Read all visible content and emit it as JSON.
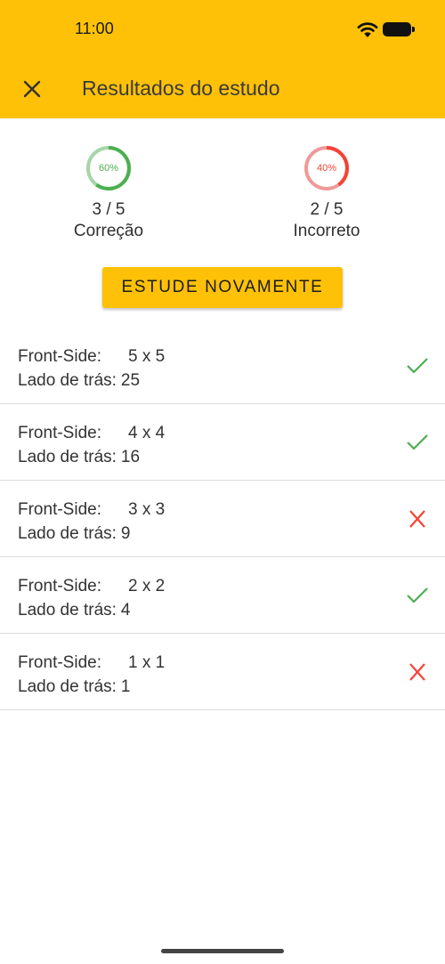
{
  "status_bar": {
    "time": "11:00",
    "wifi_icon": "wifi-icon",
    "battery_icon": "battery-icon"
  },
  "app_bar": {
    "title": "Resultados do estudo",
    "close_icon": "close-icon",
    "background": "#FFC107"
  },
  "stats": {
    "correct": {
      "percent_text": "60%",
      "fraction": 0.6,
      "count": "3 / 5",
      "label": "Correção",
      "color": "#4CAF50",
      "track_color": "#A5D6A7"
    },
    "incorrect": {
      "percent_text": "40%",
      "fraction": 0.4,
      "count": "2 / 5",
      "label": "Incorreto",
      "color": "#F44336",
      "track_color": "#EF9A9A"
    }
  },
  "study_again_button": {
    "label": "ESTUDE NOVAMENTE"
  },
  "cards": [
    {
      "front_label": "Front-Side:",
      "front_value": "5 x 5",
      "back_label": "Lado de trás:",
      "back_value": "25",
      "result": "correct",
      "icon": "check-icon"
    },
    {
      "front_label": "Front-Side:",
      "front_value": "4 x 4",
      "back_label": "Lado de trás:",
      "back_value": "16",
      "result": "correct",
      "icon": "check-icon"
    },
    {
      "front_label": "Front-Side:",
      "front_value": "3 x 3",
      "back_label": "Lado de trás:",
      "back_value": "9",
      "result": "incorrect",
      "icon": "cross-icon"
    },
    {
      "front_label": "Front-Side:",
      "front_value": "2 x 2",
      "back_label": "Lado de trás:",
      "back_value": "4",
      "result": "correct",
      "icon": "check-icon"
    },
    {
      "front_label": "Front-Side:",
      "front_value": "1 x 1",
      "back_label": "Lado de trás:",
      "back_value": "1",
      "result": "incorrect",
      "icon": "cross-icon"
    }
  ],
  "colors": {
    "correct": "#4CAF50",
    "incorrect": "#F44336",
    "divider": "#DCDCDC"
  }
}
